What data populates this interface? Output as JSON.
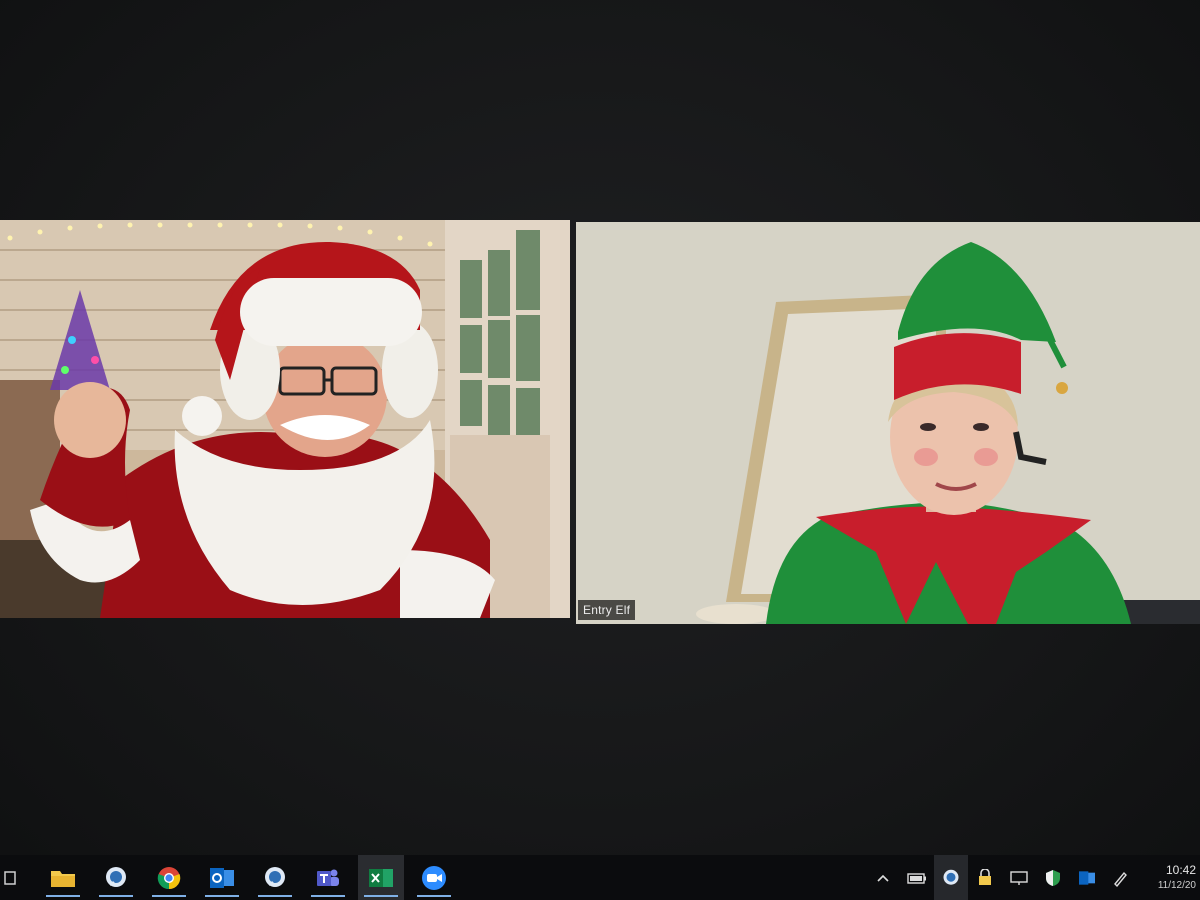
{
  "meeting": {
    "participants": [
      {
        "name_label": ""
      },
      {
        "name_label": "Entry Elf"
      }
    ]
  },
  "taskbar": {
    "apps": [
      {
        "icon": "task-view-icon"
      },
      {
        "icon": "file-explorer-icon",
        "active": true
      },
      {
        "icon": "chat-app-icon",
        "active": true
      },
      {
        "icon": "chrome-icon",
        "active": true
      },
      {
        "icon": "outlook-icon",
        "active": true
      },
      {
        "icon": "chat-app-icon",
        "active": true
      },
      {
        "icon": "teams-icon",
        "active": true
      },
      {
        "icon": "excel-icon",
        "active": true
      },
      {
        "icon": "zoom-icon",
        "active": true
      }
    ],
    "tray": {
      "time": "10:42",
      "date": "11/12/20"
    }
  },
  "colors": {
    "taskbar": "#0b0c0e",
    "accent": "#7fb0e6",
    "santa_red": "#b5151a",
    "elf_green": "#1f8f3a"
  }
}
